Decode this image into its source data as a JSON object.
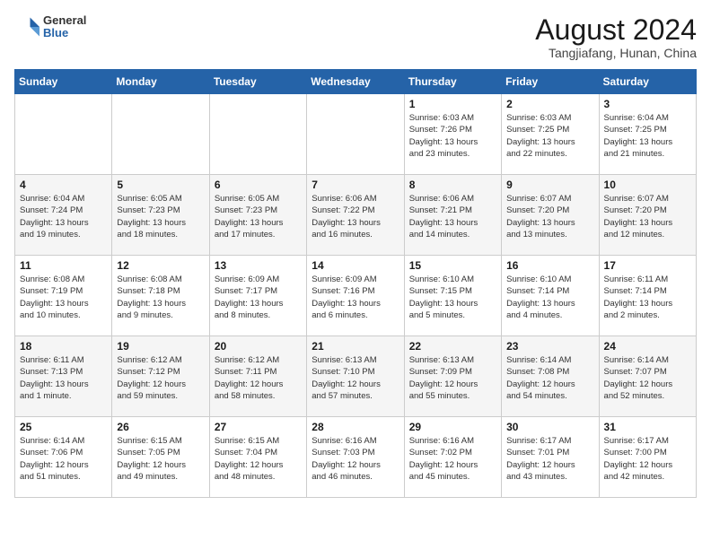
{
  "header": {
    "logo_line1": "General",
    "logo_line2": "Blue",
    "month_year": "August 2024",
    "location": "Tangjiafang, Hunan, China"
  },
  "weekdays": [
    "Sunday",
    "Monday",
    "Tuesday",
    "Wednesday",
    "Thursday",
    "Friday",
    "Saturday"
  ],
  "weeks": [
    [
      {
        "day": "",
        "info": ""
      },
      {
        "day": "",
        "info": ""
      },
      {
        "day": "",
        "info": ""
      },
      {
        "day": "",
        "info": ""
      },
      {
        "day": "1",
        "info": "Sunrise: 6:03 AM\nSunset: 7:26 PM\nDaylight: 13 hours\nand 23 minutes."
      },
      {
        "day": "2",
        "info": "Sunrise: 6:03 AM\nSunset: 7:25 PM\nDaylight: 13 hours\nand 22 minutes."
      },
      {
        "day": "3",
        "info": "Sunrise: 6:04 AM\nSunset: 7:25 PM\nDaylight: 13 hours\nand 21 minutes."
      }
    ],
    [
      {
        "day": "4",
        "info": "Sunrise: 6:04 AM\nSunset: 7:24 PM\nDaylight: 13 hours\nand 19 minutes."
      },
      {
        "day": "5",
        "info": "Sunrise: 6:05 AM\nSunset: 7:23 PM\nDaylight: 13 hours\nand 18 minutes."
      },
      {
        "day": "6",
        "info": "Sunrise: 6:05 AM\nSunset: 7:23 PM\nDaylight: 13 hours\nand 17 minutes."
      },
      {
        "day": "7",
        "info": "Sunrise: 6:06 AM\nSunset: 7:22 PM\nDaylight: 13 hours\nand 16 minutes."
      },
      {
        "day": "8",
        "info": "Sunrise: 6:06 AM\nSunset: 7:21 PM\nDaylight: 13 hours\nand 14 minutes."
      },
      {
        "day": "9",
        "info": "Sunrise: 6:07 AM\nSunset: 7:20 PM\nDaylight: 13 hours\nand 13 minutes."
      },
      {
        "day": "10",
        "info": "Sunrise: 6:07 AM\nSunset: 7:20 PM\nDaylight: 13 hours\nand 12 minutes."
      }
    ],
    [
      {
        "day": "11",
        "info": "Sunrise: 6:08 AM\nSunset: 7:19 PM\nDaylight: 13 hours\nand 10 minutes."
      },
      {
        "day": "12",
        "info": "Sunrise: 6:08 AM\nSunset: 7:18 PM\nDaylight: 13 hours\nand 9 minutes."
      },
      {
        "day": "13",
        "info": "Sunrise: 6:09 AM\nSunset: 7:17 PM\nDaylight: 13 hours\nand 8 minutes."
      },
      {
        "day": "14",
        "info": "Sunrise: 6:09 AM\nSunset: 7:16 PM\nDaylight: 13 hours\nand 6 minutes."
      },
      {
        "day": "15",
        "info": "Sunrise: 6:10 AM\nSunset: 7:15 PM\nDaylight: 13 hours\nand 5 minutes."
      },
      {
        "day": "16",
        "info": "Sunrise: 6:10 AM\nSunset: 7:14 PM\nDaylight: 13 hours\nand 4 minutes."
      },
      {
        "day": "17",
        "info": "Sunrise: 6:11 AM\nSunset: 7:14 PM\nDaylight: 13 hours\nand 2 minutes."
      }
    ],
    [
      {
        "day": "18",
        "info": "Sunrise: 6:11 AM\nSunset: 7:13 PM\nDaylight: 13 hours\nand 1 minute."
      },
      {
        "day": "19",
        "info": "Sunrise: 6:12 AM\nSunset: 7:12 PM\nDaylight: 12 hours\nand 59 minutes."
      },
      {
        "day": "20",
        "info": "Sunrise: 6:12 AM\nSunset: 7:11 PM\nDaylight: 12 hours\nand 58 minutes."
      },
      {
        "day": "21",
        "info": "Sunrise: 6:13 AM\nSunset: 7:10 PM\nDaylight: 12 hours\nand 57 minutes."
      },
      {
        "day": "22",
        "info": "Sunrise: 6:13 AM\nSunset: 7:09 PM\nDaylight: 12 hours\nand 55 minutes."
      },
      {
        "day": "23",
        "info": "Sunrise: 6:14 AM\nSunset: 7:08 PM\nDaylight: 12 hours\nand 54 minutes."
      },
      {
        "day": "24",
        "info": "Sunrise: 6:14 AM\nSunset: 7:07 PM\nDaylight: 12 hours\nand 52 minutes."
      }
    ],
    [
      {
        "day": "25",
        "info": "Sunrise: 6:14 AM\nSunset: 7:06 PM\nDaylight: 12 hours\nand 51 minutes."
      },
      {
        "day": "26",
        "info": "Sunrise: 6:15 AM\nSunset: 7:05 PM\nDaylight: 12 hours\nand 49 minutes."
      },
      {
        "day": "27",
        "info": "Sunrise: 6:15 AM\nSunset: 7:04 PM\nDaylight: 12 hours\nand 48 minutes."
      },
      {
        "day": "28",
        "info": "Sunrise: 6:16 AM\nSunset: 7:03 PM\nDaylight: 12 hours\nand 46 minutes."
      },
      {
        "day": "29",
        "info": "Sunrise: 6:16 AM\nSunset: 7:02 PM\nDaylight: 12 hours\nand 45 minutes."
      },
      {
        "day": "30",
        "info": "Sunrise: 6:17 AM\nSunset: 7:01 PM\nDaylight: 12 hours\nand 43 minutes."
      },
      {
        "day": "31",
        "info": "Sunrise: 6:17 AM\nSunset: 7:00 PM\nDaylight: 12 hours\nand 42 minutes."
      }
    ]
  ]
}
